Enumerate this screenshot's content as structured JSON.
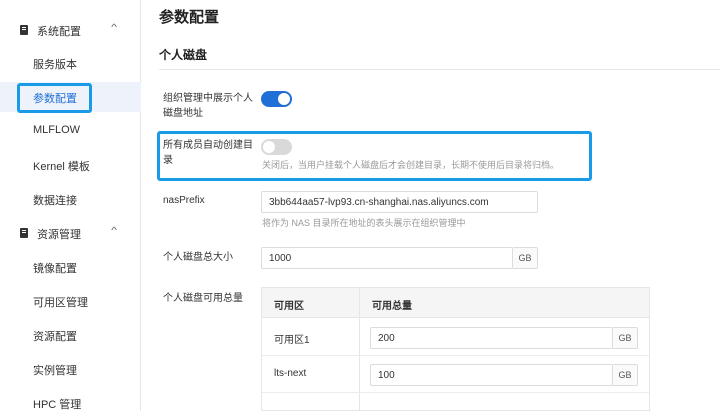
{
  "sidebar": {
    "groups": [
      {
        "label": "系统配置",
        "items": [
          "服务版本",
          "参数配置",
          "MLFLOW",
          "Kernel 模板",
          "数据连接"
        ]
      },
      {
        "label": "资源管理",
        "items": [
          "镜像配置",
          "可用区管理",
          "资源配置",
          "实例管理",
          "HPC 管理"
        ]
      }
    ],
    "active_item": "参数配置"
  },
  "page": {
    "title": "参数配置",
    "section_title": "个人磁盘"
  },
  "settings": {
    "show_disk_address": {
      "label_line1": "组织管理中展示个人",
      "label_line2": "磁盘地址",
      "enabled": true
    },
    "auto_create_dir": {
      "label_line1": "所有成员自动创建目",
      "label_line2": "录",
      "enabled": false,
      "hint": "关闭后，当用户挂载个人磁盘后才会创建目录，长期不使用后目录将归档。"
    },
    "nas_prefix": {
      "label": "nasPrefix",
      "value": "3bb644aa57-lvp93.cn-shanghai.nas.aliyuncs.com",
      "hint": "将作为 NAS 目录所在地址的表头展示在组织管理中"
    },
    "total_size": {
      "label": "个人磁盘总大小",
      "value": "1000",
      "unit": "GB"
    },
    "available_total": {
      "label": "个人磁盘可用总量",
      "columns": [
        "可用区",
        "可用总量"
      ],
      "rows": [
        {
          "zone": "可用区1",
          "value": "200",
          "unit": "GB"
        },
        {
          "zone": "lts-next",
          "value": "100",
          "unit": "GB"
        }
      ]
    }
  },
  "colors": {
    "accent": "#1f6fd6",
    "highlight_box": "#1a9be8"
  },
  "icons": {
    "group_icon": "document-icon",
    "expand_icon": "chevron-up-icon"
  }
}
